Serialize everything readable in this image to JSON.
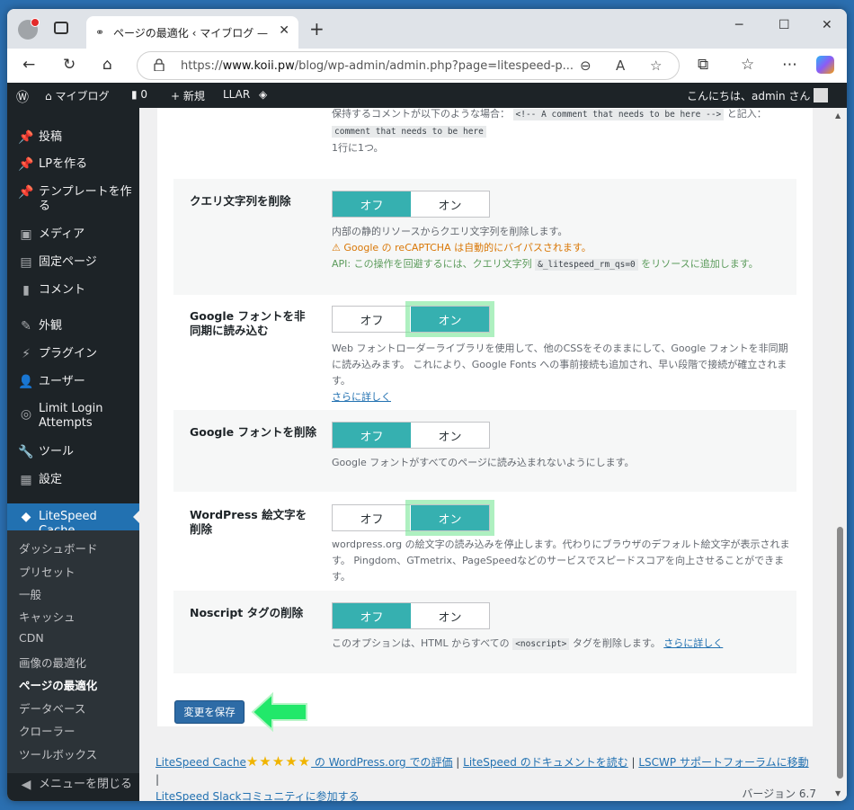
{
  "browser": {
    "tab_title": "ページの最適化 ‹ マイブログ — WordPress",
    "url_prefix": "https://",
    "url_domain": "www.koii.pw",
    "url_path": "/blog/wp-admin/admin.php?page=litespeed-p..."
  },
  "adminbar": {
    "site_name": "マイブログ",
    "comments_count": "0",
    "new_label": "新規",
    "llar_label": "LLAR",
    "greeting": "こんにちは、admin さん"
  },
  "sidebar": {
    "items": [
      {
        "label": "投稿",
        "icon": "pin-icon"
      },
      {
        "label": "LPを作る",
        "icon": "pin-icon"
      },
      {
        "label": "テンプレートを作る",
        "icon": "pin-icon"
      },
      {
        "label": "メディア",
        "icon": "media-icon"
      },
      {
        "label": "固定ページ",
        "icon": "page-icon"
      },
      {
        "label": "コメント",
        "icon": "comment-icon"
      },
      {
        "label": "外観",
        "icon": "brush-icon"
      },
      {
        "label": "プラグイン",
        "icon": "plugin-icon"
      },
      {
        "label": "ユーザー",
        "icon": "user-icon"
      },
      {
        "label": "Limit Login Attempts",
        "icon": "fingerprint-icon"
      },
      {
        "label": "ツール",
        "icon": "wrench-icon"
      },
      {
        "label": "設定",
        "icon": "settings-icon"
      },
      {
        "label": "LiteSpeed Cache",
        "icon": "litespeed-icon"
      }
    ],
    "submenu": [
      "ダッシュボード",
      "プリセット",
      "一般",
      "キャッシュ",
      "CDN",
      "画像の最適化",
      "ページの最適化",
      "データベース",
      "クローラー",
      "ツールボックス"
    ],
    "collapse_label": "メニューを閉じる"
  },
  "top_desc": {
    "line1_prefix": "保持するコメントが以下のような場合：",
    "code1": "<!-- A comment that needs to be here -->",
    "line1_suffix": "と記入：",
    "code2": "comment that needs to be here",
    "line2": "1行に1つ。"
  },
  "settings": [
    {
      "label": "クエリ文字列を削除",
      "off": "オフ",
      "on": "オン",
      "state": "off",
      "desc": "内部の静的リソースからクエリ文字列を削除します。",
      "warn": "⚠ Google の reCAPTCHA は自動的にバイパスされます。",
      "api_prefix": "API: この操作を回避するには、クエリ文字列",
      "api_code": "&_litespeed_rm_qs=0",
      "api_suffix": "をリソースに追加します。"
    },
    {
      "label": "Google フォントを非同期に読み込む",
      "off": "オフ",
      "on": "オン",
      "state": "on",
      "desc": "Web フォントローダーライブラリを使用して、他のCSSをそのままにして、Google フォントを非同期に読み込みます。 これにより、Google Fonts への事前接続も追加され、早い段階で接続が確立されます。",
      "link": "さらに詳しく"
    },
    {
      "label": "Google フォントを削除",
      "off": "オフ",
      "on": "オン",
      "state": "off",
      "desc": "Google フォントがすべてのページに読み込まれないようにします。"
    },
    {
      "label": "WordPress 絵文字を削除",
      "off": "オフ",
      "on": "オン",
      "state": "on",
      "desc": "wordpress.org の絵文字の読み込みを停止します。代わりにブラウザのデフォルト絵文字が表示されます。 Pingdom、GTmetrix、PageSpeedなどのサービスでスピードスコアを向上させることができます。"
    },
    {
      "label": "Noscript タグの削除",
      "off": "オフ",
      "on": "オン",
      "state": "off",
      "desc_prefix": "このオプションは、HTML からすべての",
      "desc_code": "<noscript>",
      "desc_suffix": "タグを削除します。",
      "link": "さらに詳しく"
    }
  ],
  "save_label": "変更を保存",
  "footer": {
    "brand": "LiteSpeed Cache",
    "stars": "★★★★★",
    "rating_text": " の WordPress.org での評価",
    "docs": "LiteSpeed のドキュメントを読む",
    "forum": "LSCWP サポートフォーラムに移動",
    "slack": "LiteSpeed Slackコミュニティに参加する",
    "sep": " | "
  },
  "version": "バージョン 6.7",
  "colors": {
    "toggle_on": "#36b0b0",
    "wp_blue": "#2271b1",
    "adminbar": "#1d2327",
    "highlight": "#78e696"
  }
}
